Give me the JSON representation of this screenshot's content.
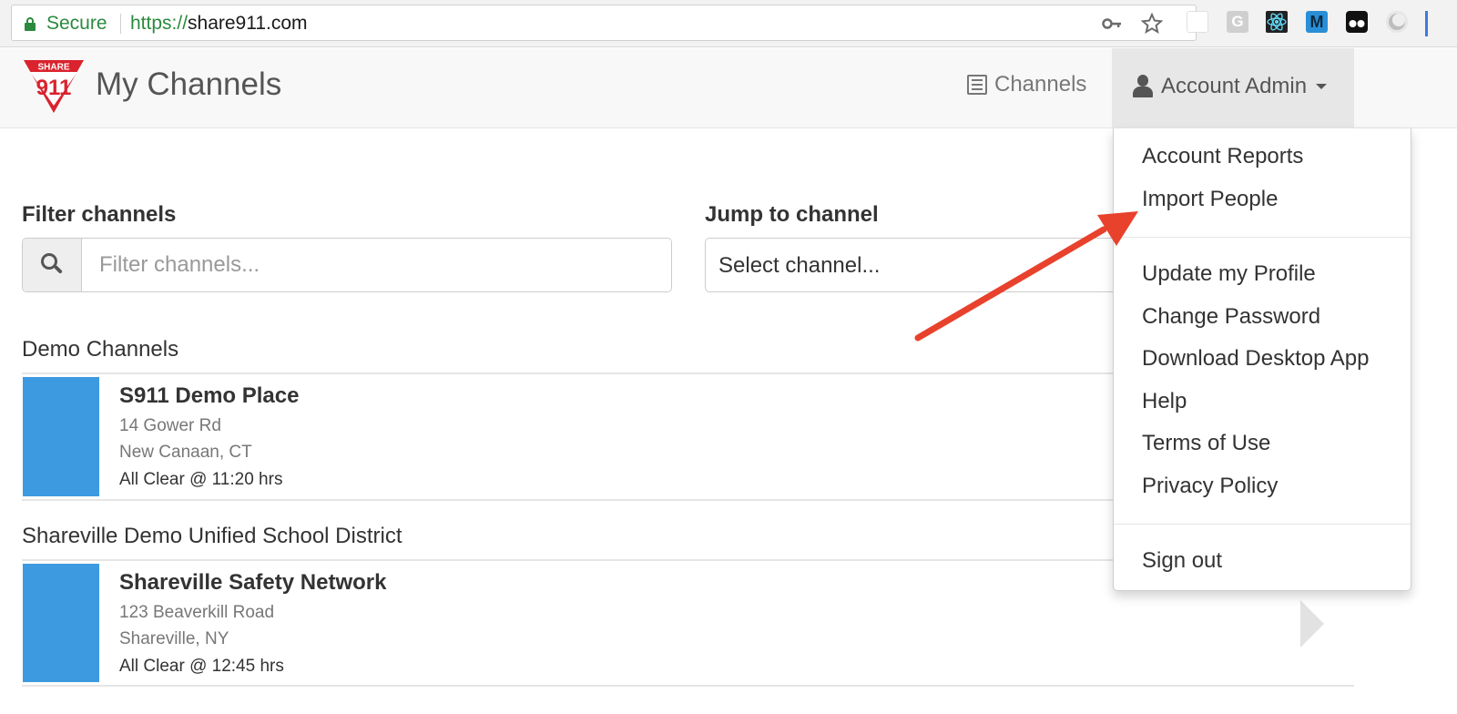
{
  "browser": {
    "secure_label": "Secure",
    "url_scheme": "https://",
    "url_host": "share911.com",
    "icons": [
      "key-icon",
      "star-icon"
    ],
    "extensions": [
      "blank-extension-icon",
      "g-extension-icon",
      "react-extension-icon",
      "m-extension-icon",
      "glasses-extension-icon",
      "circle-extension-icon"
    ],
    "extension_m_label": "M",
    "extension_g_label": "G"
  },
  "navbar": {
    "logo_text_top": "SHARE",
    "logo_text_main": "911",
    "title": "My Channels",
    "channels_label": "Channels",
    "account_label": "Account Admin"
  },
  "filters": {
    "filter_label": "Filter channels",
    "filter_placeholder": "Filter channels...",
    "jump_label": "Jump to channel",
    "jump_selected": "Select channel..."
  },
  "groups": [
    {
      "title": "Demo Channels",
      "channels": [
        {
          "name": "S911 Demo Place",
          "address1": "14 Gower Rd",
          "address2": "New Canaan, CT",
          "status": "All Clear @ 11:20 hrs"
        }
      ]
    },
    {
      "title": "Shareville Demo Unified School District",
      "channels": [
        {
          "name": "Shareville Safety Network",
          "address1": "123 Beaverkill Road",
          "address2": "Shareville, NY",
          "status": "All Clear @ 12:45 hrs"
        }
      ]
    }
  ],
  "dropdown": {
    "items": [
      "Account Reports",
      "Import People",
      "Update my Profile",
      "Change Password",
      "Download Desktop App",
      "Help",
      "Terms of Use",
      "Privacy Policy",
      "Sign out"
    ]
  },
  "colors": {
    "accent_blue": "#3d9ae0",
    "annotation_arrow": "#e8412c",
    "secure_green": "#2b8a3e",
    "logo_red": "#d9232e"
  }
}
